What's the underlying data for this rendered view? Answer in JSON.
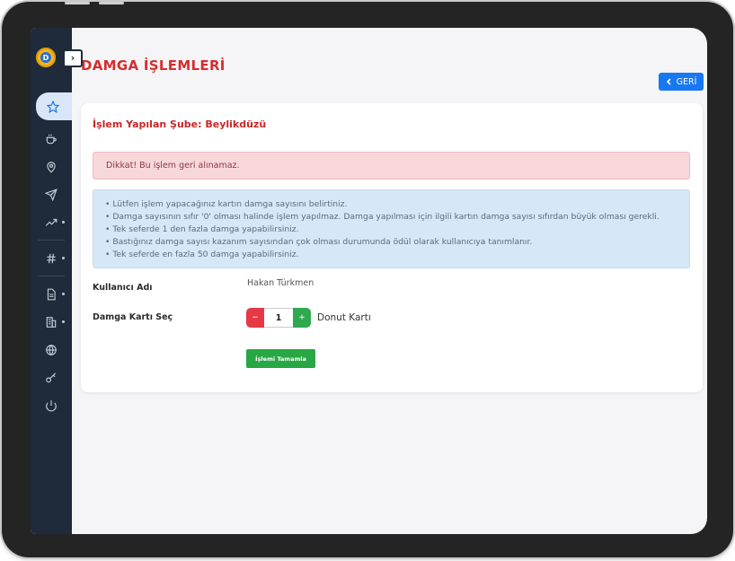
{
  "page": {
    "title": "DAMGA İŞLEMLERİ",
    "back_label": "GERİ",
    "branch_label": "İşlem Yapılan Şube: Beylikdüzü"
  },
  "alerts": {
    "warning": "Dikkat! Bu işlem geri alınamaz.",
    "info_lines": [
      "• Lütfen işlem yapacağınız kartın damga sayısını belirtiniz.",
      "• Damga sayısının sıfır '0' olması halinde işlem yapılmaz. Damga yapılması için ilgili kartın damga sayısı sıfırdan büyük olması gerekli.",
      "• Tek seferde 1 den fazla damga yapabilirsiniz.",
      "• Bastığınız damga sayısı kazanım sayısından çok olması durumunda ödül olarak kullanıcıya tanımlanır.",
      "• Tek seferde en fazla 50 damga yapabilirsiniz."
    ]
  },
  "form": {
    "user_label": "Kullanıcı Adı",
    "user_value": "Hakan Türkmen",
    "card_label": "Damga Kartı Seç",
    "stepper": {
      "minus": "−",
      "value": "1",
      "plus": "+"
    },
    "card_name": "Donut Kartı",
    "submit_label": "İşlemi Tamamla"
  },
  "sidebar": {
    "logo_letter": "D",
    "toggle_glyph": "›",
    "items": [
      {
        "icon": "star-icon",
        "active": true
      },
      {
        "icon": "coffee-icon"
      },
      {
        "icon": "location-icon"
      },
      {
        "icon": "send-icon"
      },
      {
        "icon": "trending-icon",
        "has_dot": true
      },
      {
        "icon": "hash-icon",
        "has_dot": true
      },
      {
        "icon": "document-icon",
        "has_dot": true
      },
      {
        "icon": "building-icon",
        "has_dot": true
      },
      {
        "icon": "globe-icon"
      },
      {
        "icon": "key-icon"
      },
      {
        "icon": "power-icon"
      }
    ]
  },
  "colors": {
    "accent": "#1877f2",
    "title": "#d32f2f",
    "sidebar": "#1f2b3a",
    "danger": "#e53945",
    "success": "#28a745"
  }
}
